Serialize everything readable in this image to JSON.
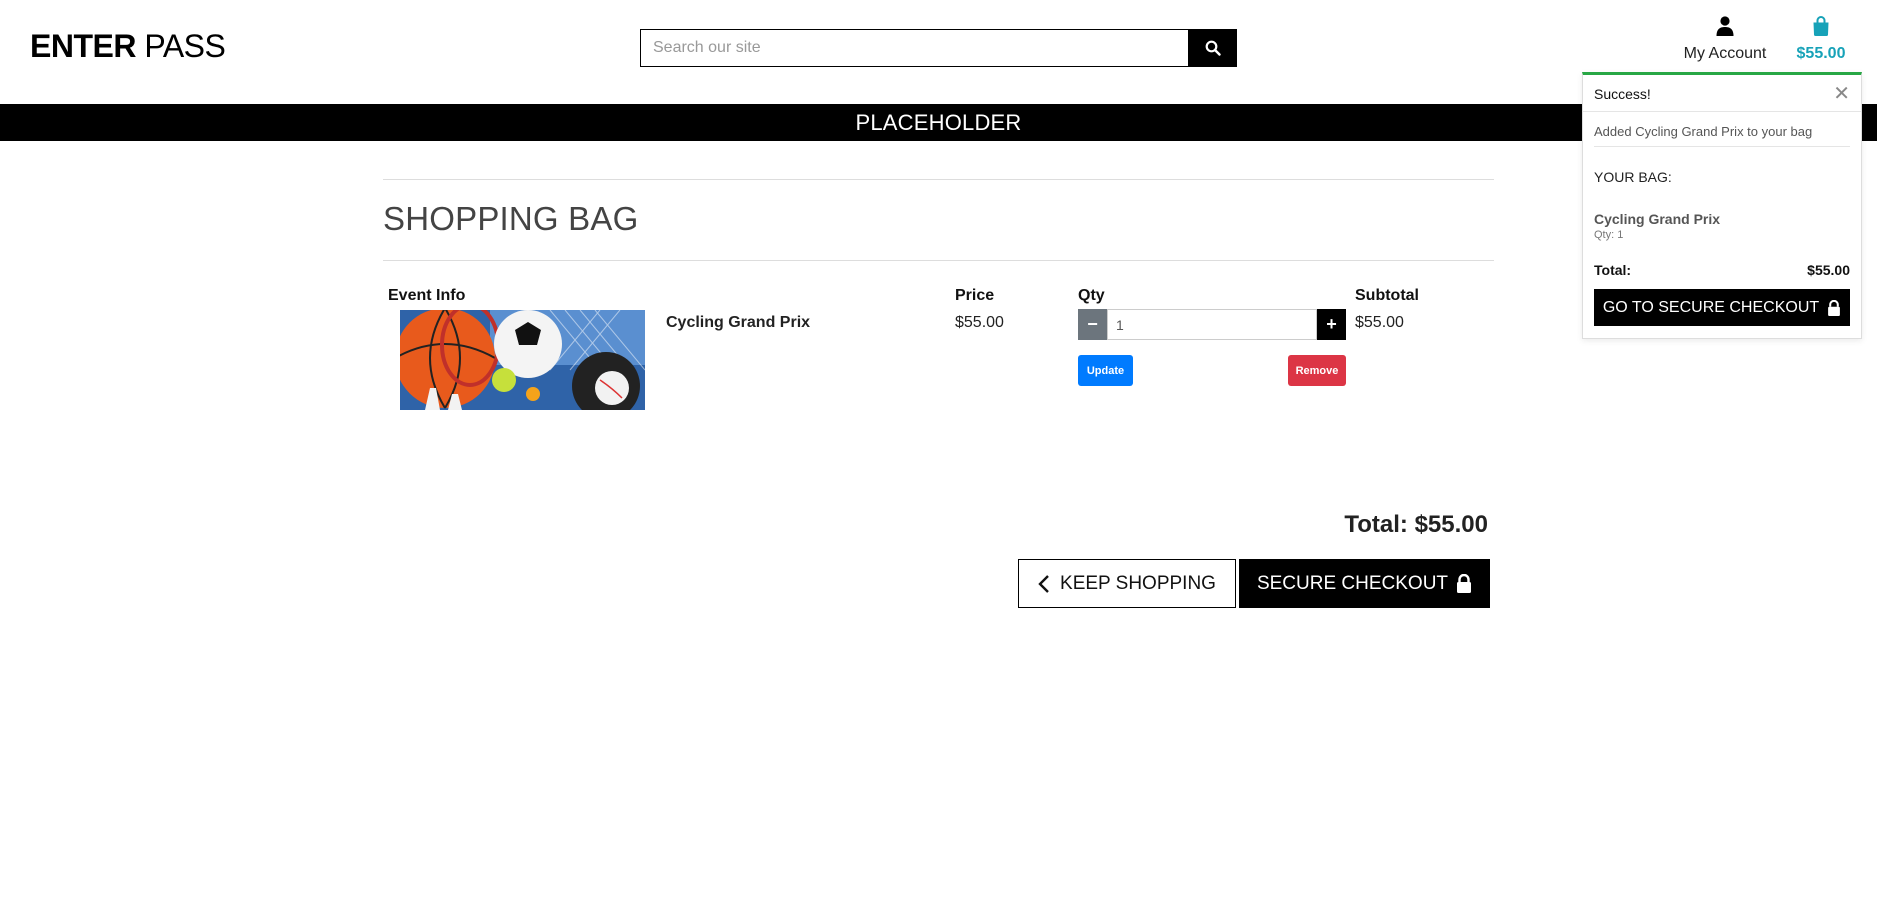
{
  "header": {
    "logo_bold": "ENTER",
    "logo_light": "PASS",
    "search": {
      "placeholder": "Search our site"
    },
    "account_label": "My Account",
    "bag_total": "$55.00",
    "accent_color": "#17a2b8"
  },
  "banner": {
    "text": "PLACEHOLDER"
  },
  "bag": {
    "title": "SHOPPING BAG",
    "columns": {
      "event_info": "Event Info",
      "price": "Price",
      "qty": "Qty",
      "subtotal": "Subtotal"
    },
    "items": [
      {
        "name": "Cycling Grand Prix",
        "price": "$55.00",
        "qty": "1",
        "subtotal": "$55.00",
        "update_label": "Update",
        "remove_label": "Remove"
      }
    ],
    "total_label": "Total: $55.00",
    "keep_shopping_label": "KEEP SHOPPING",
    "secure_checkout_label": "SECURE CHECKOUT"
  },
  "toast": {
    "title": "Success!",
    "message": "Added Cycling Grand Prix to your bag",
    "bag_label": "YOUR BAG:",
    "item_name": "Cycling Grand Prix",
    "item_qty": "Qty: 1",
    "total_label": "Total:",
    "total_value": "$55.00",
    "button_label": "GO TO SECURE CHECKOUT",
    "status_color": "#28a745"
  }
}
